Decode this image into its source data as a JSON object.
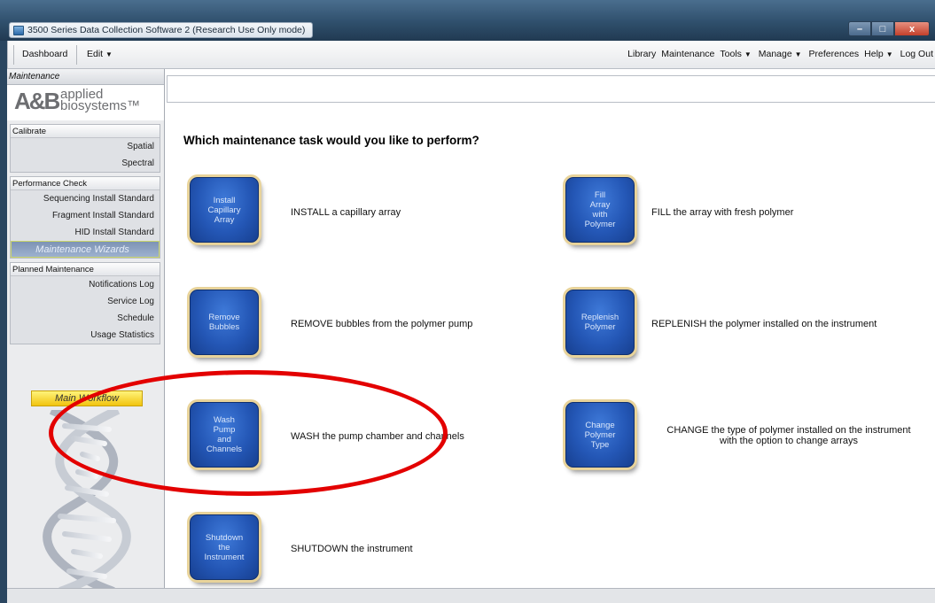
{
  "window": {
    "title": "3500 Series Data Collection Software 2 (Research Use Only mode)",
    "controls": [
      "–",
      "□",
      "x"
    ]
  },
  "menubar": {
    "dashboard": "Dashboard",
    "edit": "Edit",
    "library": "Library",
    "maintenance": "Maintenance",
    "tools": "Tools",
    "manage": "Manage",
    "preferences": "Preferences",
    "help": "Help",
    "logout": "Log Out",
    "caret": "▼"
  },
  "nav": {
    "header": "Maintenance",
    "logo_mark": "A&B",
    "logo_line1": "applied",
    "logo_line2": "biosystems™",
    "sections": {
      "calibrate": {
        "title": "Calibrate",
        "items": [
          "Spatial",
          "Spectral"
        ]
      },
      "performance": {
        "title": "Performance Check",
        "items": [
          "Sequencing Install Standard",
          "Fragment Install Standard",
          "HID Install Standard"
        ]
      },
      "wizards": "Maintenance Wizards",
      "planned": {
        "title": "Planned Maintenance",
        "items": [
          "Notifications Log",
          "Service Log",
          "Schedule",
          "Usage Statistics"
        ]
      }
    },
    "main_workflow": "Main Workflow"
  },
  "main": {
    "heading": "Which maintenance task would you like to perform?",
    "tasks": [
      {
        "button": "Install\nCapillary\nArray",
        "desc": "INSTALL a capillary array"
      },
      {
        "button": "Fill\nArray\nwith\nPolymer",
        "desc": "FILL the array with fresh polymer"
      },
      {
        "button": "Remove\nBubbles",
        "desc": "REMOVE bubbles from the polymer pump"
      },
      {
        "button": "Replenish\nPolymer",
        "desc": "REPLENISH the polymer installed on the instrument"
      },
      {
        "button": "Wash\nPump\nand\nChannels",
        "desc": "WASH the pump chamber and channels"
      },
      {
        "button": "Change\nPolymer\nType",
        "desc_line1": "CHANGE the type of polymer installed on the instrument",
        "desc_line2": "with the option to change arrays"
      },
      {
        "button": "Shutdown\nthe\nInstrument",
        "desc": "SHUTDOWN the instrument"
      }
    ]
  },
  "colors": {
    "task_button": "#2457b6",
    "annotation": "#e30000",
    "active_nav": "#7d93b4",
    "main_workflow": "#f1c40f"
  }
}
